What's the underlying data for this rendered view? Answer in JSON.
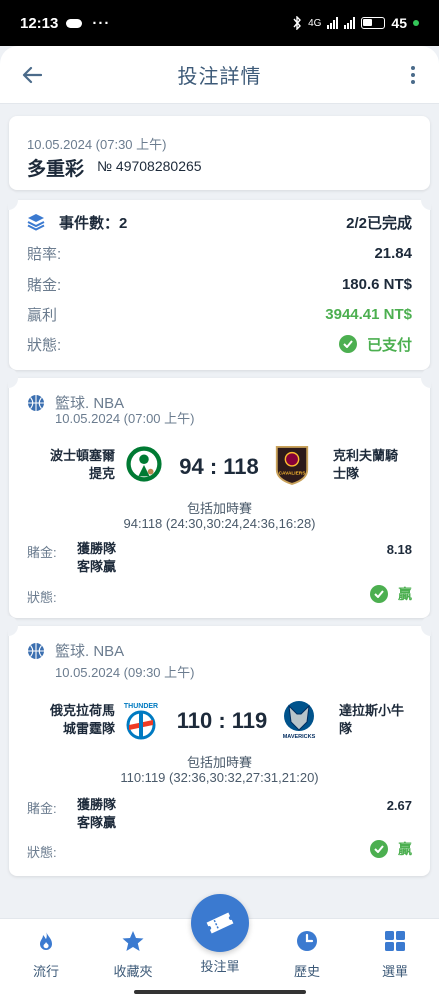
{
  "status_bar": {
    "time": "12:13",
    "dots": "···",
    "net_label": "4G",
    "battery": "45"
  },
  "header": {
    "title": "投注詳情"
  },
  "summary": {
    "date": "10.05.2024 (07:30 上午)",
    "type": "多重彩",
    "ticket": "№ 49708280265"
  },
  "details": {
    "events_label": "事件數：2",
    "events_value": "2/2已完成",
    "odds_label": "賠率:",
    "odds_value": "21.84",
    "stake_label": "賭金:",
    "stake_value": "180.6 NT$",
    "win_label": "贏利",
    "win_value": "3944.41 NT$",
    "status_label": "狀態:",
    "status_value": "已支付"
  },
  "matches": [
    {
      "league": "籃球. NBA",
      "date": "10.05.2024 (07:00 上午)",
      "home_line1": "波士頓塞爾",
      "home_line2": "提克",
      "away_line1": "克利夫蘭騎",
      "away_line2": "士隊",
      "score": "94 : 118",
      "ot": "包括加時賽",
      "detail": "94:118 (24:30,30:24,24:36,16:28)",
      "bet_label": "賭金:",
      "bet_line1": "獲勝隊",
      "bet_line2": "客隊贏",
      "odds": "8.18",
      "status_label": "狀態:",
      "status_value": "贏"
    },
    {
      "league": "籃球. NBA",
      "date": "10.05.2024 (09:30 上午)",
      "home_line1": "俄克拉荷馬",
      "home_line2": "城雷霆隊",
      "away_line1": "達拉斯小牛",
      "away_line2": "隊",
      "score": "110 : 119",
      "ot": "包括加時賽",
      "detail": "110:119 (32:36,30:32,27:31,21:20)",
      "bet_label": "賭金:",
      "bet_line1": "獲勝隊",
      "bet_line2": "客隊贏",
      "odds": "2.67",
      "status_label": "狀態:",
      "status_value": "贏"
    }
  ],
  "logos": {
    "cavs_text": "CAVALIERS",
    "thunder_text": "THUNDER",
    "mavs_text": "MAVERICKS"
  },
  "nav": {
    "items": [
      {
        "label": "流行",
        "icon": "fire-icon"
      },
      {
        "label": "收藏夾",
        "icon": "star-icon"
      },
      {
        "label": "投注單",
        "icon": "ticket-icon"
      },
      {
        "label": "歷史",
        "icon": "clock-icon"
      },
      {
        "label": "選單",
        "icon": "grid-icon"
      }
    ]
  },
  "colors": {
    "accent": "#3b7ad0",
    "success": "#4caf50",
    "header_text": "#3d5a78"
  }
}
